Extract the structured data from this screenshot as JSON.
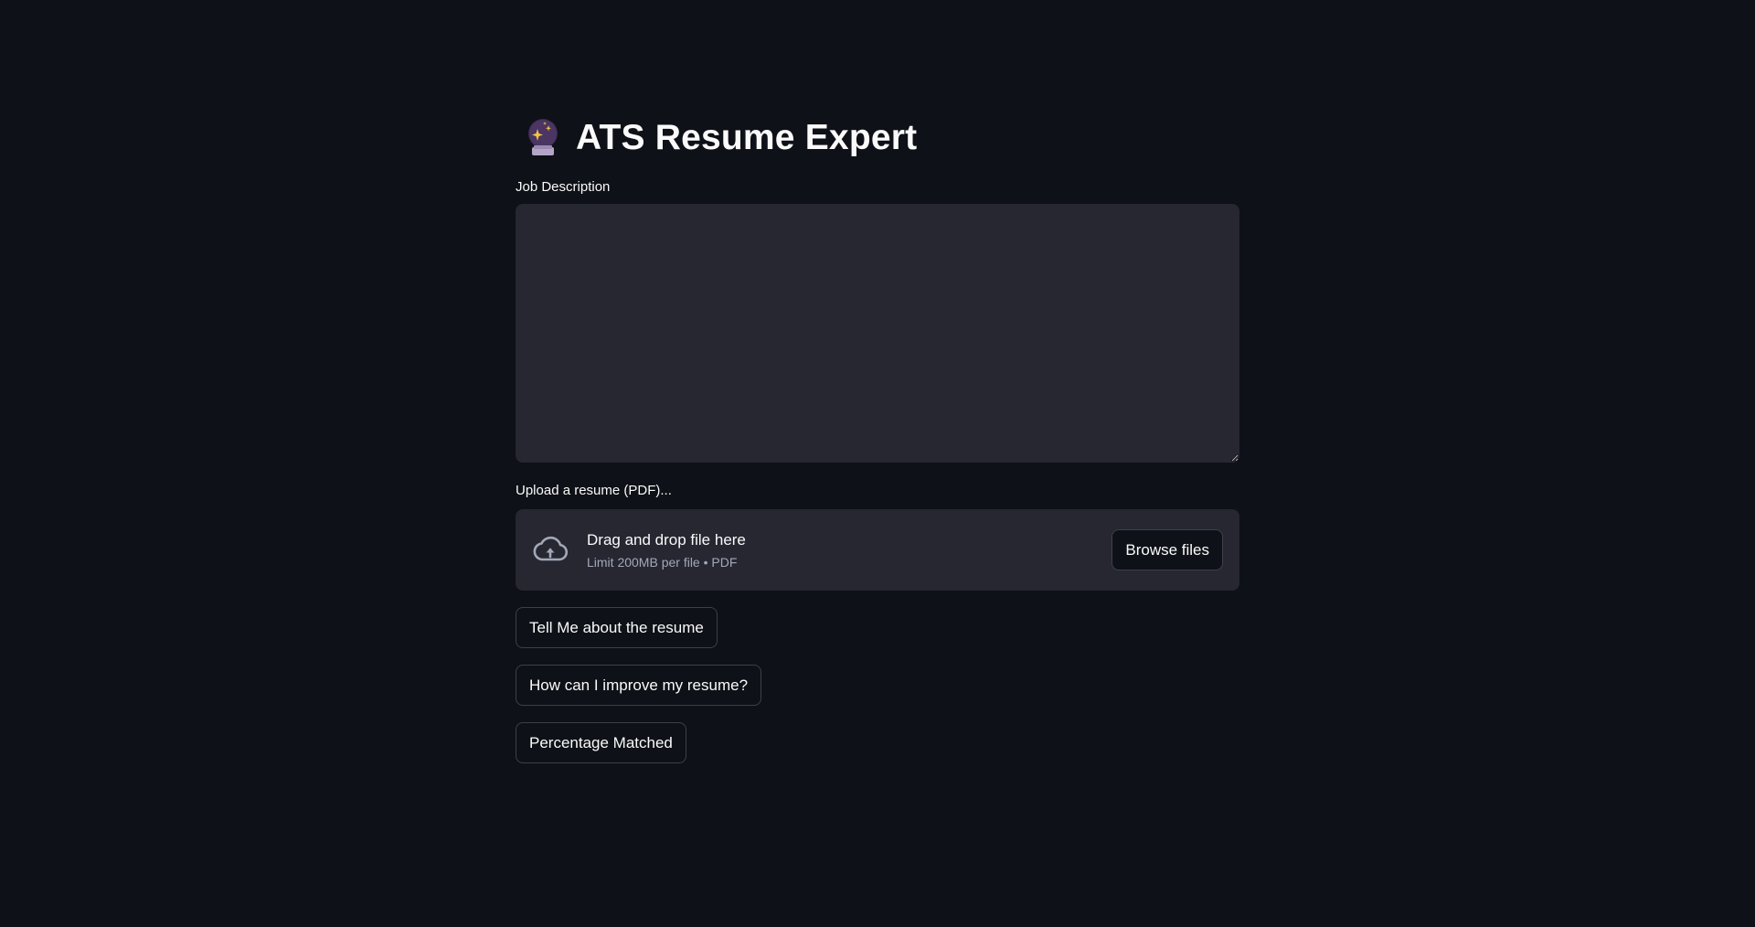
{
  "header": {
    "title": "ATS Resume Expert",
    "icon": "crystal-ball-icon"
  },
  "job_description": {
    "label": "Job Description",
    "value": "",
    "placeholder": ""
  },
  "upload": {
    "label": "Upload a resume (PDF)...",
    "drop_text": "Drag and drop file here",
    "limit_text": "Limit 200MB per file • PDF",
    "browse_label": "Browse files",
    "icon": "cloud-upload-icon"
  },
  "actions": {
    "tell_me_label": "Tell Me about the resume",
    "improve_label": "How can I improve my resume?",
    "percentage_label": "Percentage Matched"
  },
  "colors": {
    "background": "#0e1117",
    "surface": "#262730",
    "text": "#fafafa",
    "muted_text": "#a3a8b8",
    "border": "#3d404b"
  }
}
